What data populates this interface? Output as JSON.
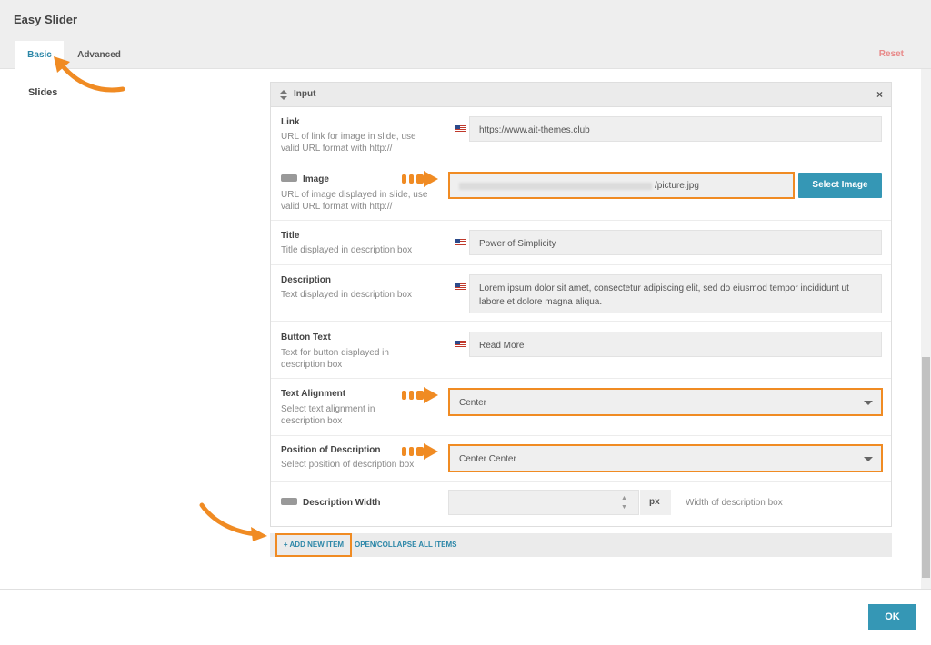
{
  "window": {
    "title": "Easy Slider"
  },
  "tabs": {
    "basic": "Basic",
    "advanced": "Advanced"
  },
  "reset_label": "Reset",
  "section": {
    "slides_label": "Slides"
  },
  "panel": {
    "title": "Input",
    "sort_icon": "sort-arrows-icon",
    "close_icon": "×"
  },
  "fields": {
    "link": {
      "label": "Link",
      "desc": "URL of link for image in slide, use valid URL format with http://",
      "value": "https://www.ait-themes.club"
    },
    "image": {
      "label": "Image",
      "desc": "URL of image displayed in slide, use valid URL format with http://",
      "value": "/picture.jpg",
      "button": "Select Image"
    },
    "title": {
      "label": "Title",
      "desc": "Title displayed in description box",
      "value": "Power of Simplicity"
    },
    "description": {
      "label": "Description",
      "desc": "Text displayed in description box",
      "value": "Lorem ipsum dolor sit amet, consectetur adipiscing elit, sed do eiusmod tempor incididunt ut labore et dolore magna aliqua."
    },
    "button_text": {
      "label": "Button Text",
      "desc": "Text for button displayed in description box",
      "value": "Read More"
    },
    "text_alignment": {
      "label": "Text Alignment",
      "desc": "Select text alignment in description box",
      "value": "Center"
    },
    "position": {
      "label": "Position of Description",
      "desc": "Select position of description box",
      "value": "Center Center"
    },
    "width": {
      "label": "Description Width",
      "unit": "px",
      "hint": "Width of description box",
      "stepper_up": "▲",
      "stepper_down": "▼"
    }
  },
  "footer": {
    "add_item": "+ ADD NEW ITEM",
    "open_collapse": "OPEN/COLLAPSE ALL ITEMS"
  },
  "ok_label": "OK",
  "colors": {
    "accent": "#3597b5",
    "highlight": "#f08b23",
    "reset": "#e88a8a"
  }
}
